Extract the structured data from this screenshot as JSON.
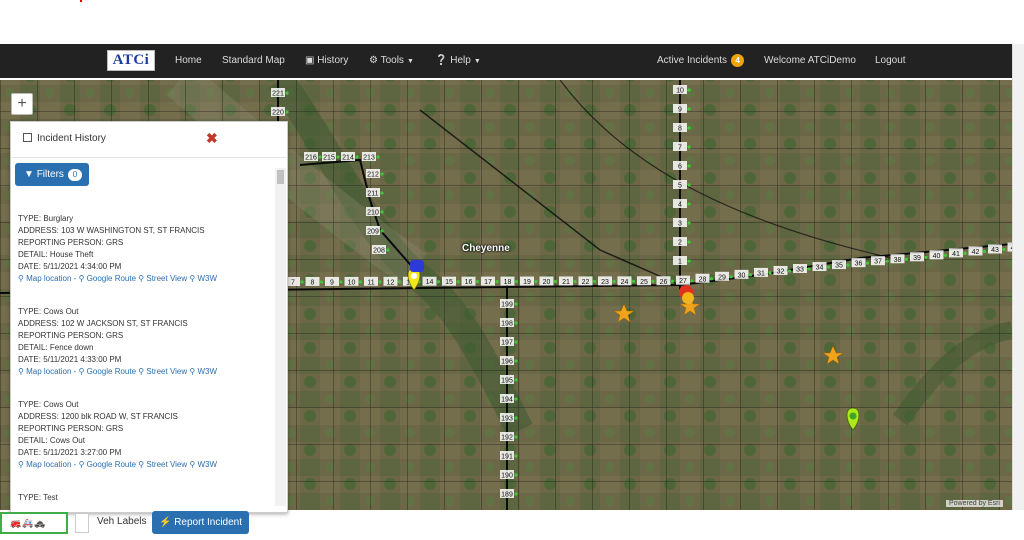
{
  "nav": {
    "logo": "ATCi",
    "home": "Home",
    "standard_map": "Standard Map",
    "history": "History",
    "tools": "Tools",
    "help": "Help",
    "active_incidents": "Active Incidents",
    "active_count": "4",
    "welcome": "Welcome ATCiDemo",
    "logout": "Logout"
  },
  "map": {
    "city": "Cheyenne",
    "attribution": "Powered by Esri",
    "zoom_in": "+",
    "mile_markers_h": [
      "7",
      "8",
      "9",
      "10",
      "11",
      "12",
      "13",
      "14",
      "15",
      "16",
      "17",
      "18",
      "19",
      "20",
      "21",
      "22",
      "23",
      "24",
      "25",
      "26",
      "27",
      "28",
      "29",
      "30",
      "31",
      "32",
      "33",
      "34",
      "35",
      "36",
      "37",
      "38",
      "39",
      "40",
      "41",
      "42",
      "43",
      "44",
      "45"
    ],
    "mile_markers_v1": [
      "221",
      "220",
      "216",
      "215",
      "214",
      "213",
      "212",
      "211",
      "210",
      "209",
      "208"
    ],
    "mile_markers_v2": [
      "199",
      "198",
      "197",
      "196",
      "195",
      "194",
      "193",
      "192",
      "191",
      "190",
      "189"
    ],
    "mile_markers_v3": [
      "10",
      "9",
      "8",
      "7",
      "6",
      "5",
      "4",
      "3",
      "2",
      "1"
    ]
  },
  "panel": {
    "title": "Incident History",
    "filters_label": "Filters",
    "filters_count": "0",
    "incidents": [
      {
        "type": "TYPE: Burglary",
        "address": "ADDRESS: 103 W WASHINGTON ST, ST FRANCIS",
        "person": "REPORTING PERSON: GRS",
        "detail": "DETAIL: House Theft",
        "date": "DATE: 5/11/2021 4:34:00 PM"
      },
      {
        "type": "TYPE: Cows Out",
        "address": "ADDRESS: 102 W JACKSON ST, ST FRANCIS",
        "person": "REPORTING PERSON: GRS",
        "detail": "DETAIL: Fence down",
        "date": "DATE: 5/11/2021 4:33:00 PM"
      },
      {
        "type": "TYPE: Cows Out",
        "address": "ADDRESS: 1200 blk ROAD W, ST FRANCIS",
        "person": "REPORTING PERSON: GRS",
        "detail": "DETAIL: Cows Out",
        "date": "DATE: 5/11/2021 3:27:00 PM"
      },
      {
        "type": "TYPE: Test"
      }
    ],
    "link_map": "Map location -",
    "link_route": "Google Route",
    "link_street": "Street View",
    "link_w3w": "W3W"
  },
  "bottom": {
    "legend_icons": "🚒🚑🚓",
    "veh_labels": "Veh Labels",
    "report_incident": "Report Incident"
  },
  "colors": {
    "navbar": "#222222",
    "primary": "#2a6fb0",
    "badge": "#f0a30a",
    "close": "#c0392b",
    "road": "#000000",
    "highway_marker": "#44c63a"
  }
}
